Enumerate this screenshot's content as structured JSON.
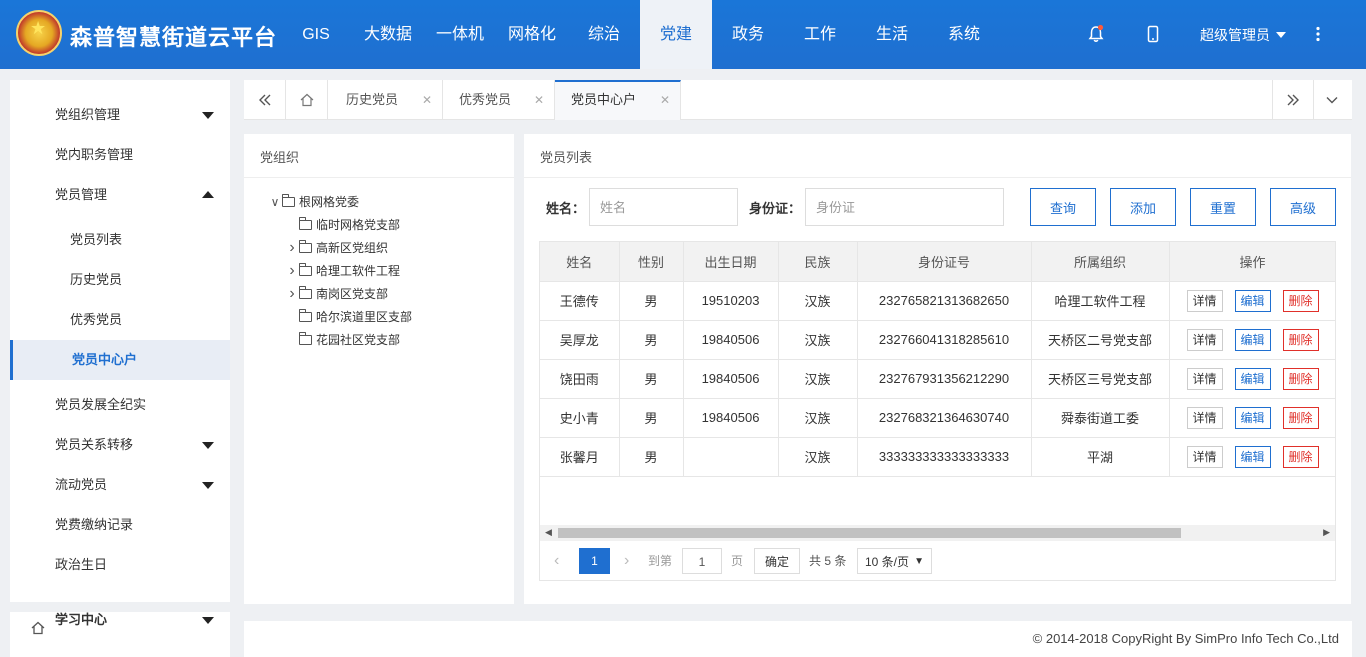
{
  "app": {
    "title": "森普智慧街道云平台",
    "accent": "#1f6fd0"
  },
  "header": {
    "nav": [
      {
        "label": "GIS"
      },
      {
        "label": "大数据"
      },
      {
        "label": "一体机"
      },
      {
        "label": "网格化"
      },
      {
        "label": "综治"
      },
      {
        "label": "党建",
        "active": true
      },
      {
        "label": "政务"
      },
      {
        "label": "工作"
      },
      {
        "label": "生活"
      },
      {
        "label": "系统"
      }
    ],
    "user": "超级管理员",
    "icons": [
      "bell-icon",
      "mobile-icon",
      "more-icon"
    ]
  },
  "sidebar": {
    "items": [
      {
        "label": "党组织管理",
        "caret": "down"
      },
      {
        "label": "党内职务管理"
      },
      {
        "label": "党员管理",
        "caret": "up"
      },
      {
        "label": "党员列表",
        "sub": true
      },
      {
        "label": "历史党员",
        "sub": true
      },
      {
        "label": "优秀党员",
        "sub": true
      },
      {
        "label": "党员中心户",
        "sub": true,
        "active": true
      },
      {
        "label": "党员发展全纪实"
      },
      {
        "label": "党员关系转移",
        "caret": "down"
      },
      {
        "label": "流动党员",
        "caret": "down"
      },
      {
        "label": "党费缴纳记录"
      },
      {
        "label": "政治生日"
      }
    ],
    "study": {
      "label": "学习中心"
    }
  },
  "tabs": [
    {
      "label": "历史党员"
    },
    {
      "label": "优秀党员"
    },
    {
      "label": "党员中心户",
      "active": true
    }
  ],
  "tree": {
    "title": "党组织",
    "root": "根网格党委",
    "children": [
      {
        "label": "临时网格党支部",
        "expandable": false
      },
      {
        "label": "高新区党组织",
        "expandable": true
      },
      {
        "label": "哈理工软件工程",
        "expandable": true
      },
      {
        "label": "南岗区党支部",
        "expandable": true
      },
      {
        "label": "哈尔滨道里区支部",
        "expandable": false
      },
      {
        "label": "花园社区党支部",
        "expandable": false
      }
    ]
  },
  "list": {
    "title": "党员列表",
    "search": {
      "name_label": "姓名：",
      "name_placeholder": "姓名",
      "id_label": "身份证：",
      "id_placeholder": "身份证"
    },
    "buttons": {
      "query": "查询",
      "add": "添加",
      "reset": "重置",
      "advanced": "高级"
    },
    "columns": [
      "姓名",
      "性别",
      "出生日期",
      "民族",
      "身份证号",
      "所属组织",
      "操作"
    ],
    "rows": [
      [
        "王德传",
        "男",
        "19510203",
        "汉族",
        "232765821313682650",
        "哈理工软件工程"
      ],
      [
        "吴厚龙",
        "男",
        "19840506",
        "汉族",
        "232766041318285610",
        "天桥区二号党支部"
      ],
      [
        "饶田雨",
        "男",
        "19840506",
        "汉族",
        "232767931356212290",
        "天桥区三号党支部"
      ],
      [
        "史小青",
        "男",
        "19840506",
        "汉族",
        "232768321364630740",
        "舜泰街道工委"
      ],
      [
        "张馨月",
        "男",
        "",
        "汉族",
        "333333333333333333",
        "平湖"
      ]
    ],
    "actions": {
      "detail": "详情",
      "edit": "编辑",
      "delete": "删除"
    },
    "pager": {
      "current": "1",
      "goto_label": "到第",
      "goto_value": "1",
      "page_unit": "页",
      "confirm": "确定",
      "total": "共 5 条",
      "page_size": "10 条/页"
    }
  },
  "footer": {
    "copyright": "© 2014-2018 CopyRight By SimPro Info Tech Co.,Ltd"
  }
}
